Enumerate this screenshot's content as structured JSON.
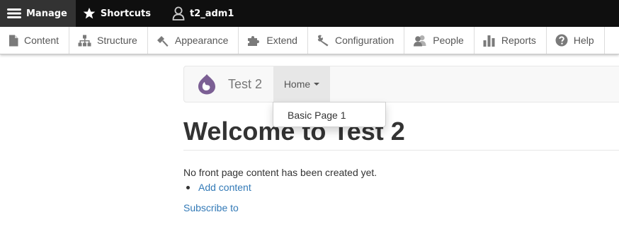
{
  "toolbar": {
    "manage_label": "Manage",
    "shortcuts_label": "Shortcuts",
    "user_label": "t2_adm1"
  },
  "tray": {
    "items": [
      {
        "label": "Content",
        "icon": "file-icon"
      },
      {
        "label": "Structure",
        "icon": "sitemap-icon"
      },
      {
        "label": "Appearance",
        "icon": "paintbrush-icon"
      },
      {
        "label": "Extend",
        "icon": "puzzle-icon"
      },
      {
        "label": "Configuration",
        "icon": "wrench-icon"
      },
      {
        "label": "People",
        "icon": "people-icon"
      },
      {
        "label": "Reports",
        "icon": "bar-chart-icon"
      },
      {
        "label": "Help",
        "icon": "help-icon"
      }
    ]
  },
  "site": {
    "name": "Test 2",
    "logo_icon": "drupal-drop-logo",
    "logo_color": "#7b5f94"
  },
  "nav": {
    "home_label": "Home",
    "dropdown_items": [
      "Basic Page 1"
    ]
  },
  "main": {
    "title": "Welcome to Test 2",
    "empty_message": "No front page content has been created yet.",
    "actions": [
      "Add content"
    ],
    "subscribe_label": "Subscribe to"
  },
  "colors": {
    "toolbar_bg": "#0f0f0f",
    "link": "#337ab7",
    "text": "#333333"
  }
}
